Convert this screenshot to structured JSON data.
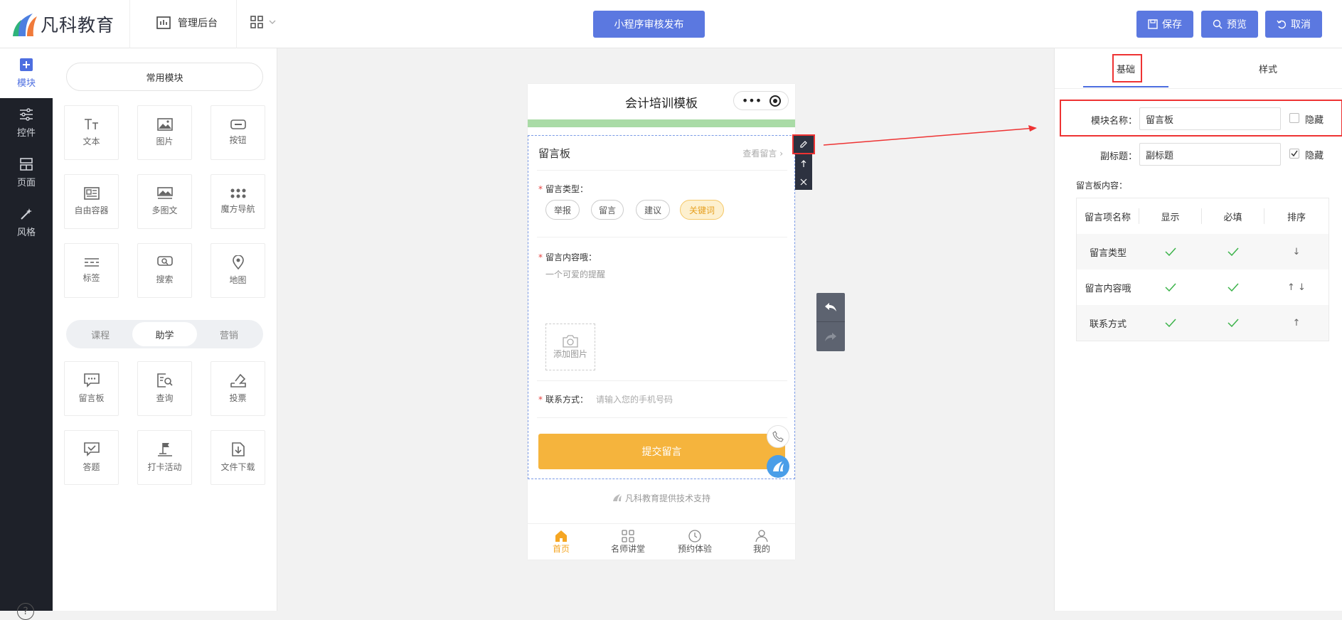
{
  "header": {
    "brand": "凡科教育",
    "admin_label": "管理后台",
    "publish_label": "小程序审核发布",
    "save_label": "保存",
    "preview_label": "预览",
    "cancel_label": "取消",
    "accent": "#5b78e0"
  },
  "leftnav": {
    "items": [
      {
        "label": "模块",
        "icon": "plus-square-icon",
        "active": true
      },
      {
        "label": "控件",
        "icon": "sliders-icon"
      },
      {
        "label": "页面",
        "icon": "layout-icon"
      },
      {
        "label": "风格",
        "icon": "magic-wand-icon"
      }
    ],
    "help": "?"
  },
  "modules": {
    "common_label": "常用模块",
    "common": [
      "文本",
      "图片",
      "按钮",
      "自由容器",
      "多图文",
      "魔方导航",
      "标签",
      "搜索",
      "地图"
    ],
    "segments": [
      "课程",
      "助学",
      "营销"
    ],
    "active_segment": "助学",
    "study": [
      "留言板",
      "查询",
      "投票",
      "答题",
      "打卡活动",
      "文件下载"
    ]
  },
  "phone": {
    "title": "会计培训模板",
    "board_title": "留言板",
    "view_more": "查看留言",
    "type_label": "留言类型：",
    "tags": [
      "举报",
      "留言",
      "建议",
      "关键词"
    ],
    "active_tag": "关键词",
    "content_label": "留言内容哦：",
    "content_placeholder": "一个可爱的提醒",
    "add_image": "添加图片",
    "contact_label": "联系方式：",
    "contact_placeholder": "请输入您的手机号码",
    "submit": "提交留言",
    "powered": "凡科教育提供技术支持",
    "tabs": [
      "首页",
      "名师讲堂",
      "预约体验",
      "我的"
    ],
    "active_tab": "首页",
    "submit_color": "#f5b43d"
  },
  "settings": {
    "tabs": [
      "基础",
      "样式"
    ],
    "active_tab": "基础",
    "module_name_label": "模块名称：",
    "module_name_value": "留言板",
    "subtitle_label": "副标题：",
    "subtitle_value": "副标题",
    "hide_label": "隐藏",
    "content_label": "留言板内容：",
    "table": {
      "headers": [
        "留言项名称",
        "显示",
        "必填",
        "排序"
      ],
      "rows": [
        {
          "name": "留言类型",
          "show": true,
          "required": true,
          "sort": "↓"
        },
        {
          "name": "留言内容哦",
          "show": true,
          "required": true,
          "sort": "↑ ↓"
        },
        {
          "name": "联系方式",
          "show": true,
          "required": true,
          "sort": "↑"
        }
      ]
    }
  }
}
